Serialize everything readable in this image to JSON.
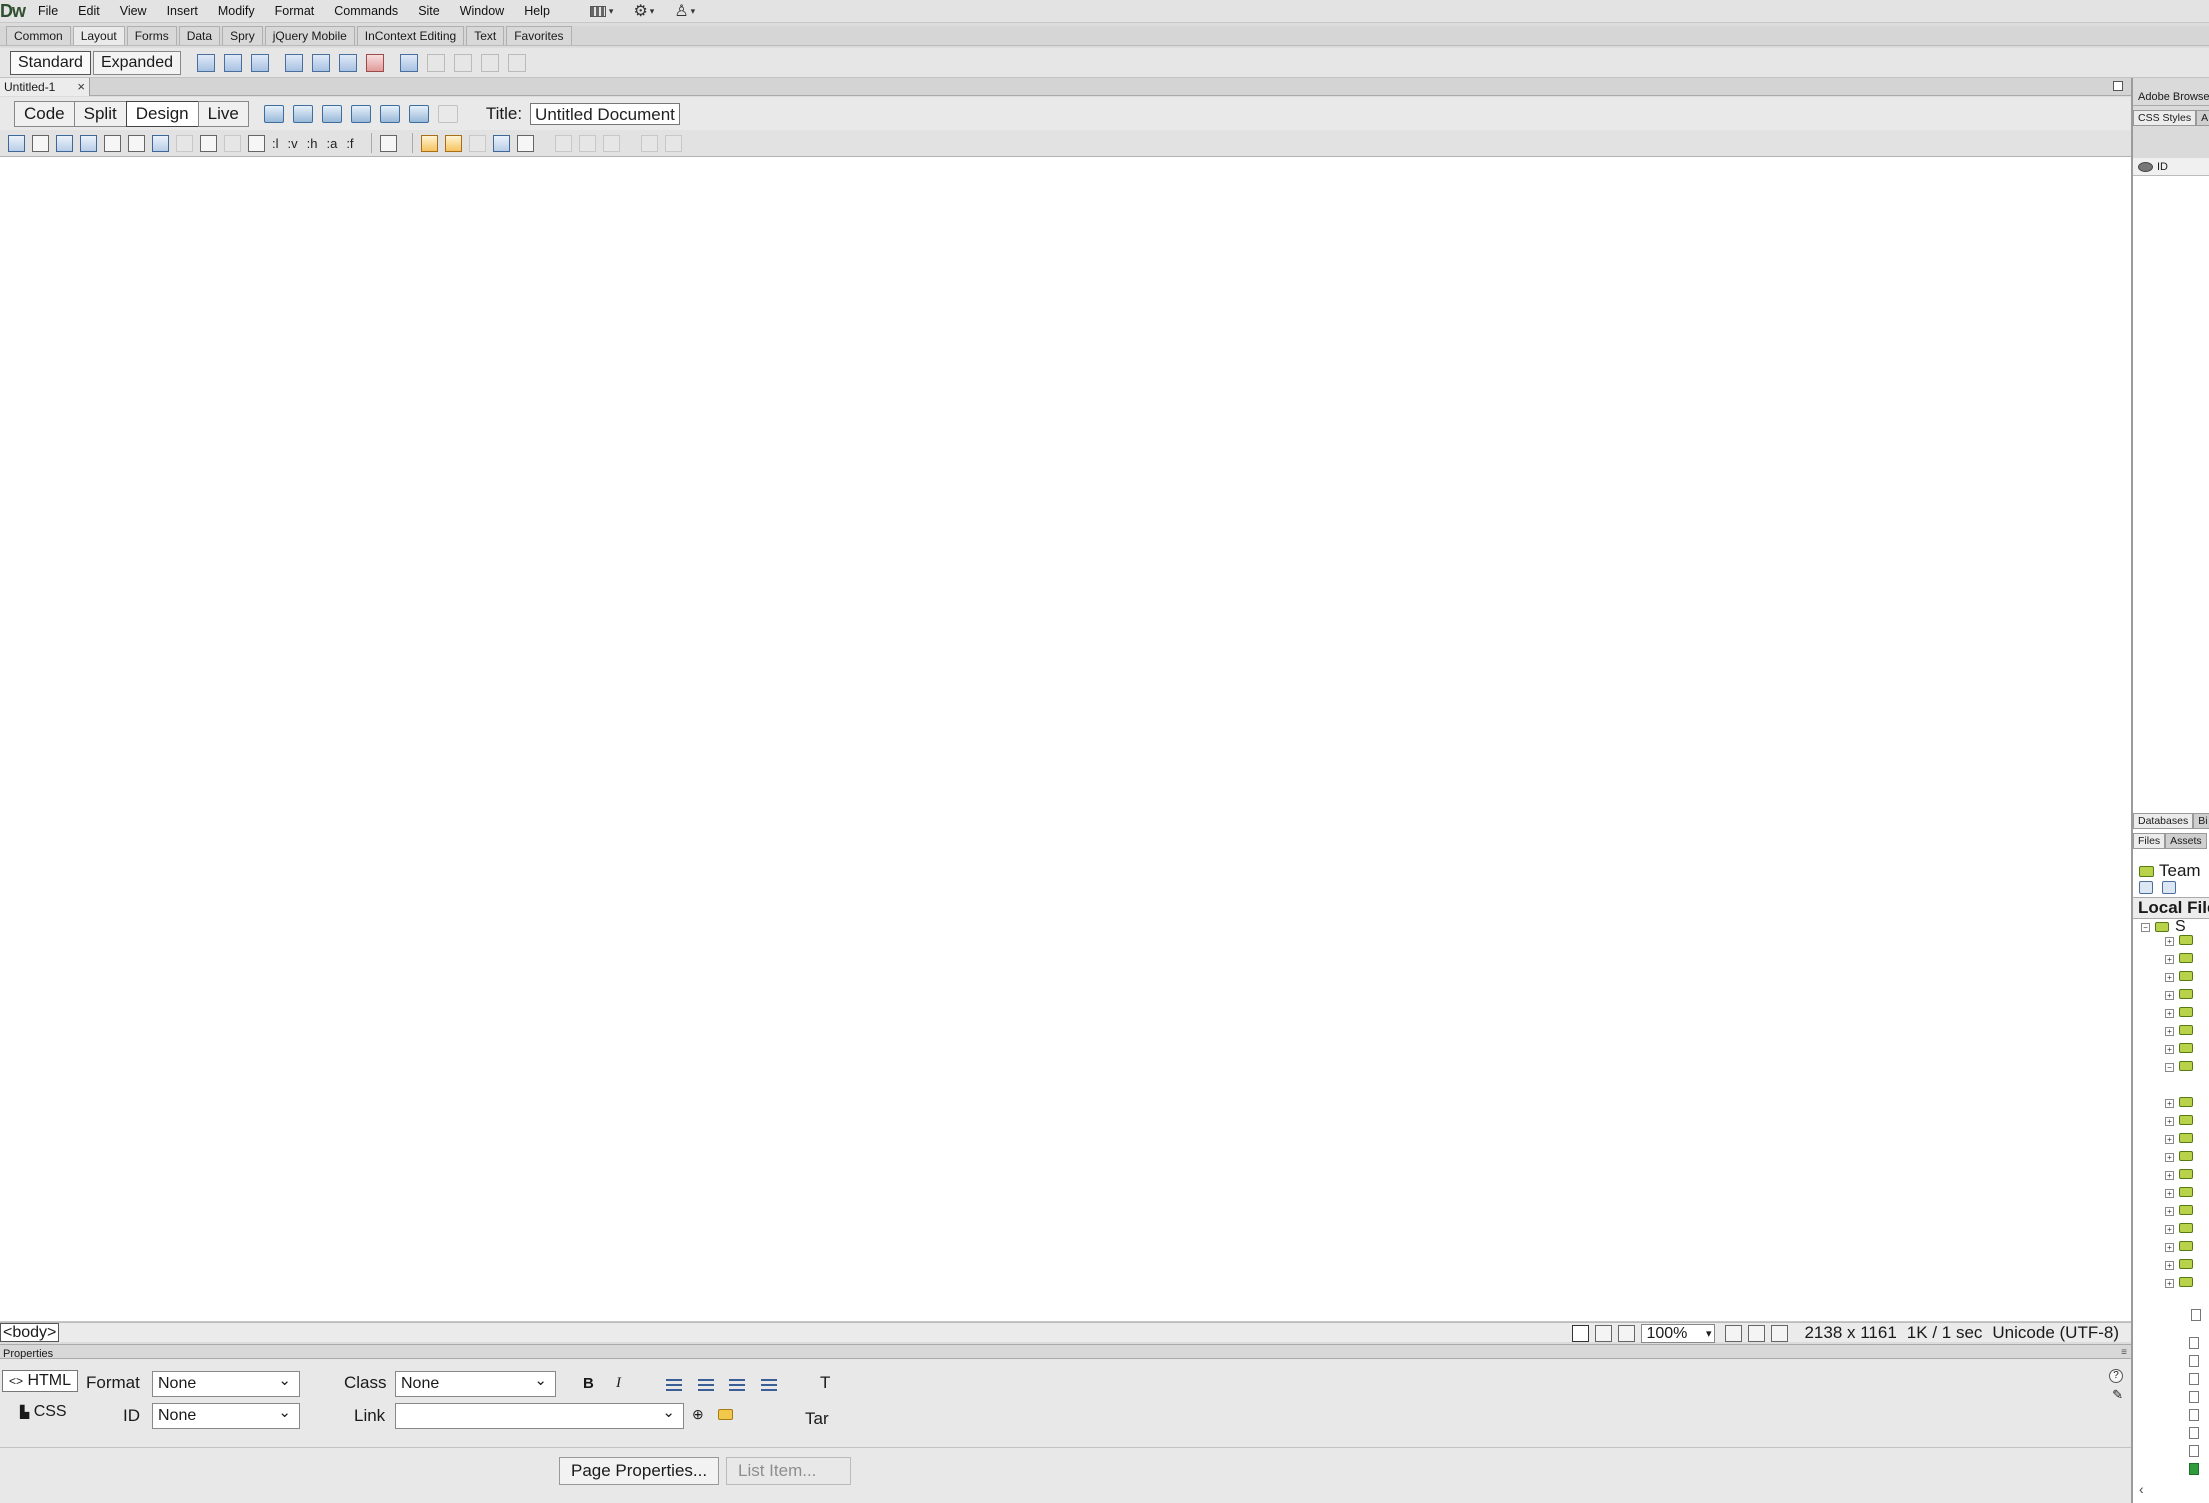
{
  "app": {
    "logo": "Dw"
  },
  "menu": {
    "items": [
      "File",
      "Edit",
      "View",
      "Insert",
      "Modify",
      "Format",
      "Commands",
      "Site",
      "Window",
      "Help"
    ],
    "layout_icon": "layout-grid-icon",
    "extend_icon": "gear-icon",
    "site_icon": "site-people-icon"
  },
  "insert_bar": {
    "tabs": [
      "Common",
      "Layout",
      "Forms",
      "Data",
      "Spry",
      "jQuery Mobile",
      "InContext Editing",
      "Text",
      "Favorites"
    ],
    "active_tab": "Layout",
    "standard_label": "Standard",
    "expanded_label": "Expanded"
  },
  "document": {
    "tab_label": "Untitled-1",
    "close_glyph": "×",
    "view_buttons": [
      "Code",
      "Split",
      "Design",
      "Live"
    ],
    "active_view": "Design",
    "title_label": "Title:",
    "title_value": "Untitled Document"
  },
  "format_toolbar": {
    "text_buttons": [
      ":l",
      ":v",
      ":h",
      ":a",
      ":f"
    ]
  },
  "status": {
    "tag": "<body>",
    "zoom": "100%",
    "window_size": "2138 x 1161",
    "download": "1K / 1 sec",
    "encoding": "Unicode (UTF-8)"
  },
  "properties": {
    "title": "Properties",
    "html_mode": "HTML",
    "css_mode": "CSS",
    "format_label": "Format",
    "format_value": "None",
    "class_label": "Class",
    "class_value": "None",
    "id_label": "ID",
    "id_value": "None",
    "link_label": "Link",
    "link_value": "",
    "bold_glyph": "B",
    "italic_glyph": "I",
    "title_partial": "T",
    "target_partial": "Tar",
    "page_properties": "Page Properties...",
    "list_item": "List Item..."
  },
  "right_panel": {
    "browserlab": "Adobe BrowserLab",
    "css_tab": "CSS Styles",
    "ap_tab": "A",
    "ap_col": "ID",
    "db_tab": "Databases",
    "bindings_tab": "Bi",
    "files_tab": "Files",
    "assets_tab": "Assets",
    "site_name": "Team",
    "local_files": "Local Files",
    "root_label": "S",
    "scroll_glyph": "‹"
  }
}
